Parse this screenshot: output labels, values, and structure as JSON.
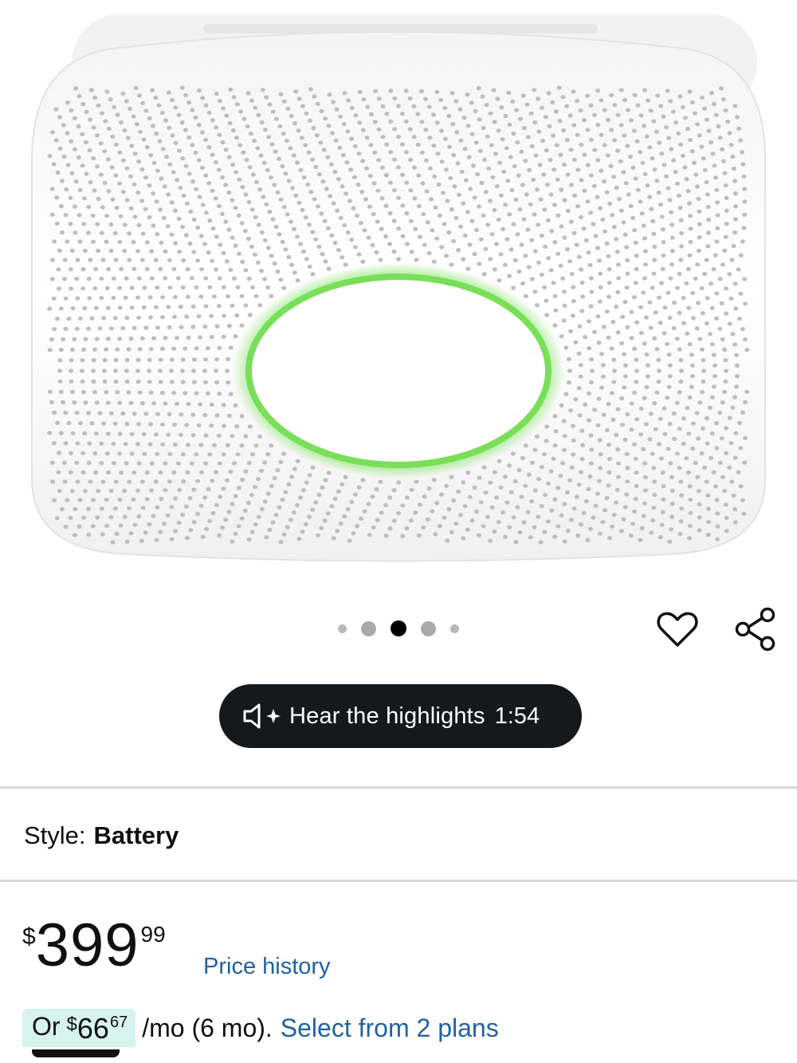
{
  "carousel": {
    "total": 5,
    "active_index": 2
  },
  "icons": {
    "wishlist": "heart-icon",
    "share": "share-icon",
    "audio": "speaker-sparkle-icon"
  },
  "audio_highlights": {
    "label": "Hear the highlights",
    "duration": "1:54"
  },
  "style": {
    "label": "Style:",
    "value": "Battery"
  },
  "price": {
    "currency": "$",
    "whole": "399",
    "fraction": "99",
    "history_link": "Price history"
  },
  "installments": {
    "prefix": "Or",
    "currency": "$",
    "whole": "66",
    "fraction": "67",
    "suffix": "/mo (6 mo).",
    "link": "Select from 2 plans"
  },
  "colors": {
    "link": "#2162a1",
    "ring": "#7ee35f",
    "pill": "#16191c",
    "installment_highlight": "#d7f3ee"
  }
}
